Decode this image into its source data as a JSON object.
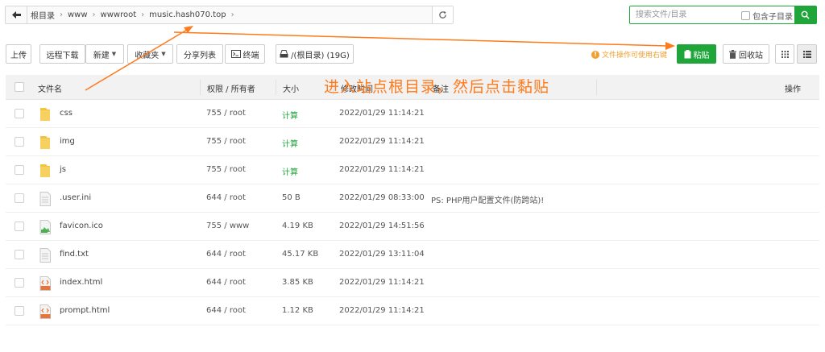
{
  "address_bar": {
    "breadcrumbs": [
      "根目录",
      "www",
      "wwwroot",
      "music.hash070.top"
    ]
  },
  "search": {
    "placeholder": "搜索文件/目录",
    "include_sub_label": "包含子目录"
  },
  "toolbar": {
    "upload": "上传",
    "remote_download": "远程下载",
    "new": "新建",
    "favorites": "收藏夹",
    "share_list": "分享列表",
    "terminal": "终端",
    "disk": "/(根目录) (19G)",
    "hint": "文件操作可使用右键",
    "paste": "粘贴",
    "recycle": "回收站"
  },
  "table": {
    "headers": {
      "name": "文件名",
      "perm": "权限 / 所有者",
      "size": "大小",
      "mtime": "修改时间",
      "note": "备注",
      "action": "操作"
    },
    "rows": [
      {
        "type": "folder",
        "name": "css",
        "perm": "755 / root",
        "size": "计算",
        "mtime": "2022/01/29 11:14:21",
        "note": ""
      },
      {
        "type": "folder",
        "name": "img",
        "perm": "755 / root",
        "size": "计算",
        "mtime": "2022/01/29 11:14:21",
        "note": ""
      },
      {
        "type": "folder",
        "name": "js",
        "perm": "755 / root",
        "size": "计算",
        "mtime": "2022/01/29 11:14:21",
        "note": ""
      },
      {
        "type": "file",
        "name": ".user.ini",
        "perm": "644 / root",
        "size": "50 B",
        "mtime": "2022/01/29 08:33:00",
        "note": "PS: PHP用户配置文件(防跨站)!"
      },
      {
        "type": "image",
        "name": "favicon.ico",
        "perm": "755 / www",
        "size": "4.19 KB",
        "mtime": "2022/01/29 14:51:56",
        "note": ""
      },
      {
        "type": "file",
        "name": "find.txt",
        "perm": "644 / root",
        "size": "45.17 KB",
        "mtime": "2022/01/29 13:11:04",
        "note": ""
      },
      {
        "type": "html",
        "name": "index.html",
        "perm": "644 / root",
        "size": "3.85 KB",
        "mtime": "2022/01/29 11:14:21",
        "note": ""
      },
      {
        "type": "html",
        "name": "prompt.html",
        "perm": "644 / root",
        "size": "1.12 KB",
        "mtime": "2022/01/29 11:14:21",
        "note": ""
      }
    ]
  },
  "annotation": {
    "text": "进入站点根目录，然后点击黏贴",
    "color": "#ff7a1a"
  },
  "colors": {
    "accent": "#20a53a",
    "hint": "#f0a030",
    "folder": "#f5c242"
  }
}
